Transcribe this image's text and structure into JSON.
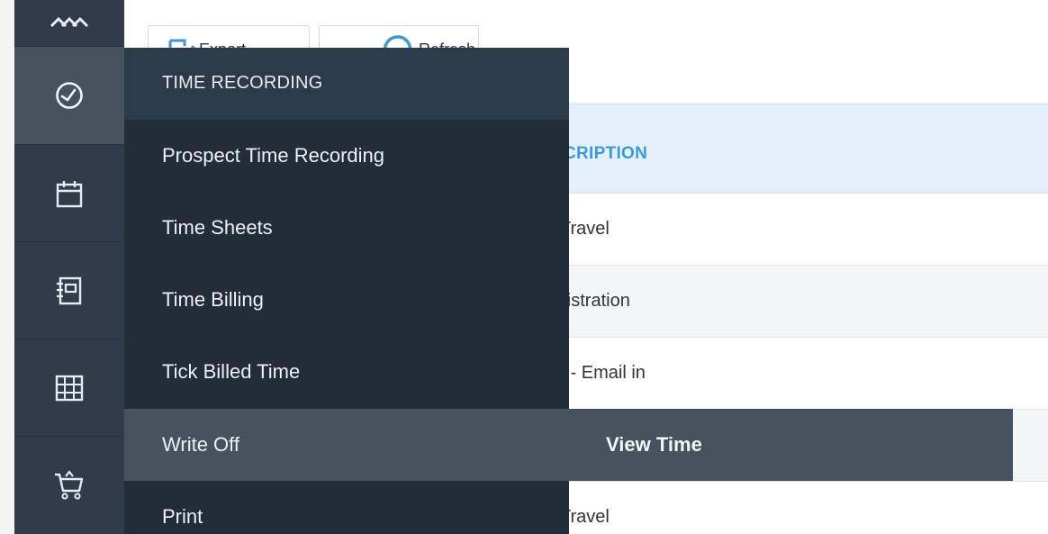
{
  "toolbar": {
    "export_label": "Export",
    "refresh_label": "Refresh"
  },
  "table": {
    "column_header": "DESCRIPTION",
    "rows": [
      {
        "description": "Travel"
      },
      {
        "description": "ADMIN - Administration"
      },
      {
        "description": "EMAILIN - Email in"
      },
      {
        "description": ""
      },
      {
        "description": "Travel"
      }
    ]
  },
  "rail": {
    "items": [
      {
        "icon": "people-icon"
      },
      {
        "icon": "clock-icon"
      },
      {
        "icon": "calendar-icon"
      },
      {
        "icon": "notebook-icon"
      },
      {
        "icon": "grid-icon"
      },
      {
        "icon": "shopping-cart-icon"
      }
    ],
    "active_index": 1
  },
  "menu": {
    "title": "TIME RECORDING",
    "items": [
      {
        "label": "Prospect Time Recording"
      },
      {
        "label": "Time Sheets"
      },
      {
        "label": "Time Billing"
      },
      {
        "label": "Tick Billed Time"
      },
      {
        "label": "Write Off"
      },
      {
        "label": "Print"
      }
    ],
    "hovered_index": 4
  },
  "submenu": {
    "items": [
      {
        "label": "View Time"
      }
    ]
  },
  "colors": {
    "rail": "#2f3d4b",
    "rail_active": "#46525e",
    "menu": "#222d38",
    "menu_header": "#2c3b4a",
    "hover": "#46525e",
    "table_header": "#e4f1fa",
    "table_header_text": "#3b9ad6"
  }
}
